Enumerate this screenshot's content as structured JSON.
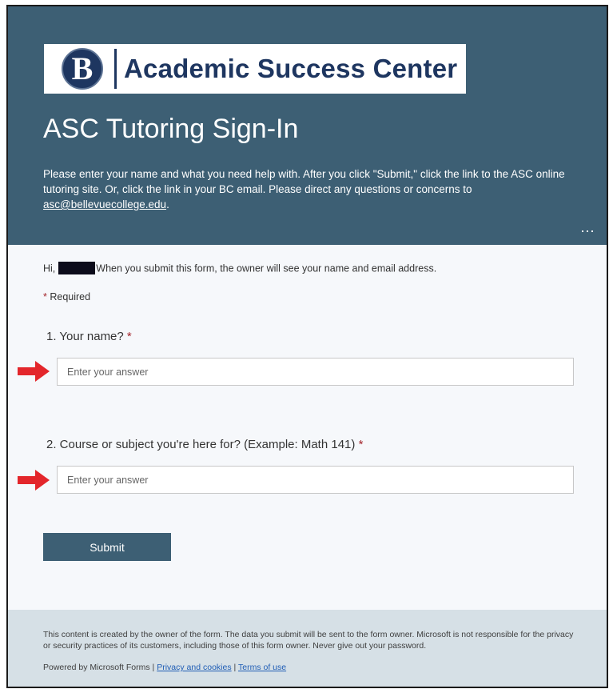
{
  "header": {
    "logo_mark": "B",
    "logo_text": "Academic Success Center",
    "title": "ASC Tutoring Sign-In",
    "description": "Please enter your name and what you need help with. After you click \"Submit,\" click the link to the ASC online tutoring site. Or, click the link in your BC email. Please direct any questions or concerns to",
    "email_link": "asc@bellevuecollege.edu",
    "description_end": ".",
    "more_icon": "⋯"
  },
  "form": {
    "hi_prefix": "Hi,",
    "hi_message": "When you submit this form, the owner will see your name and email address.",
    "required_star": "*",
    "required_label": "Required",
    "questions": [
      {
        "label": "1. Your name?",
        "star": "*",
        "placeholder": "Enter your answer",
        "value": ""
      },
      {
        "label": "2. Course or subject you're here for? (Example: Math 141)",
        "star": "*",
        "placeholder": "Enter your answer",
        "value": ""
      }
    ],
    "submit_label": "Submit"
  },
  "footer": {
    "disclaimer": "This content is created by the owner of the form. The data you submit will be sent to the form owner. Microsoft is not responsible for the privacy or security practices of its customers, including those of this form owner. Never give out your password.",
    "powered_by": "Powered by Microsoft Forms",
    "separator": "|",
    "privacy_link": "Privacy and cookies",
    "terms_link": "Terms of use"
  },
  "colors": {
    "header_bg": "#3d5f74",
    "accent_arrow": "#e3262b",
    "required_star": "#a4262c",
    "link": "#1f5db5"
  }
}
